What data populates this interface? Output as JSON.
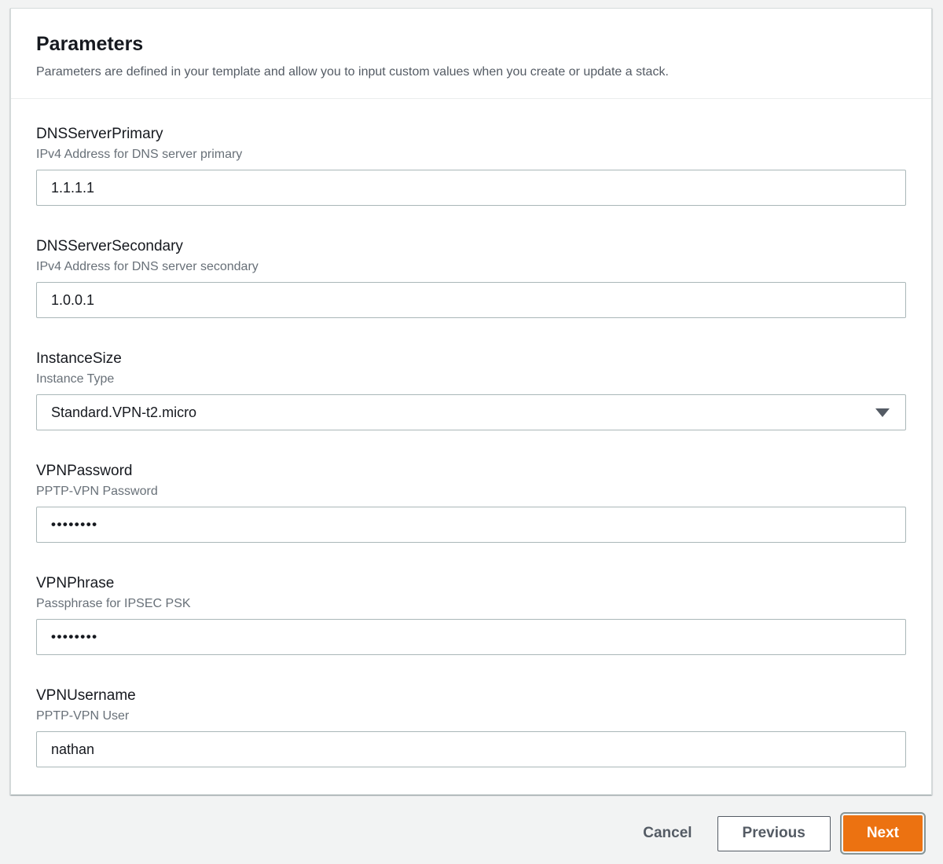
{
  "panel": {
    "title": "Parameters",
    "description": "Parameters are defined in your template and allow you to input custom values when you create or update a stack."
  },
  "fields": [
    {
      "id": "dns-server-primary",
      "label": "DNSServerPrimary",
      "description": "IPv4 Address for DNS server primary",
      "type": "text",
      "value": "1.1.1.1"
    },
    {
      "id": "dns-server-secondary",
      "label": "DNSServerSecondary",
      "description": "IPv4 Address for DNS server secondary",
      "type": "text",
      "value": "1.0.0.1"
    },
    {
      "id": "instance-size",
      "label": "InstanceSize",
      "description": "Instance Type",
      "type": "select",
      "value": "Standard.VPN-t2.micro",
      "icon": "caret-down-icon"
    },
    {
      "id": "vpn-password",
      "label": "VPNPassword",
      "description": "PPTP-VPN Password",
      "type": "password",
      "value": "••••••••"
    },
    {
      "id": "vpn-phrase",
      "label": "VPNPhrase",
      "description": "Passphrase for IPSEC PSK",
      "type": "password",
      "value": "••••••••"
    },
    {
      "id": "vpn-username",
      "label": "VPNUsername",
      "description": "PPTP-VPN User",
      "type": "text",
      "value": "nathan"
    }
  ],
  "footer": {
    "cancel_label": "Cancel",
    "previous_label": "Previous",
    "next_label": "Next"
  },
  "colors": {
    "page_background": "#f2f3f3",
    "accent_orange": "#ec7211",
    "button_text": "#545b64",
    "focus_ring": "#879596",
    "input_border": "#aab7b8"
  }
}
